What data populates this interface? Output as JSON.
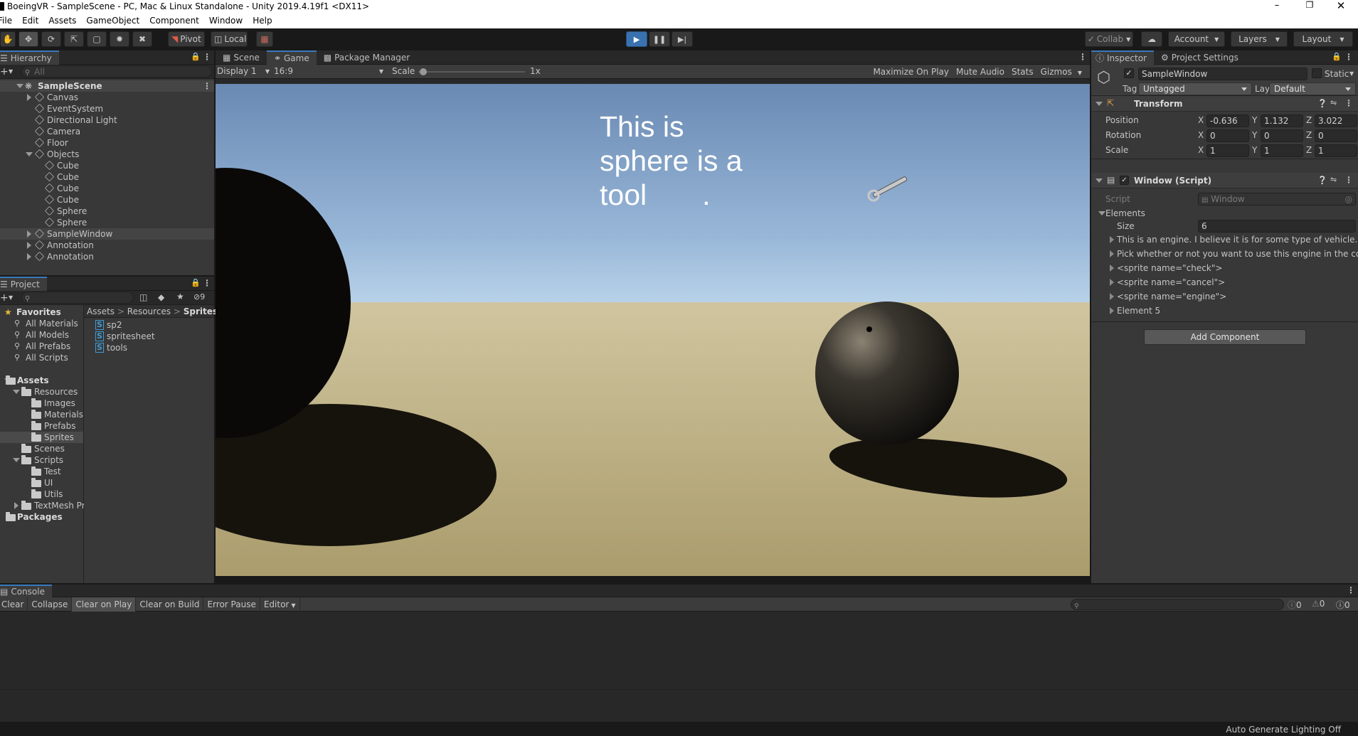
{
  "window": {
    "title": "BoeingVR - SampleScene - PC, Mac & Linux Standalone - Unity 2019.4.19f1 <DX11>"
  },
  "menu": [
    "File",
    "Edit",
    "Assets",
    "GameObject",
    "Component",
    "Window",
    "Help"
  ],
  "toolbar": {
    "pivot": "Pivot",
    "local": "Local",
    "collab": "Collab",
    "account": "Account",
    "layers": "Layers",
    "layout": "Layout"
  },
  "hierarchy": {
    "title": "Hierarchy",
    "search_placeholder": "All",
    "scene": "SampleScene",
    "items": [
      {
        "label": "Canvas",
        "depth": 1,
        "fold": "closed"
      },
      {
        "label": "EventSystem",
        "depth": 1,
        "fold": "none"
      },
      {
        "label": "Directional Light",
        "depth": 1,
        "fold": "none"
      },
      {
        "label": "Camera",
        "depth": 1,
        "fold": "none"
      },
      {
        "label": "Floor",
        "depth": 1,
        "fold": "none"
      },
      {
        "label": "Objects",
        "depth": 1,
        "fold": "open"
      },
      {
        "label": "Cube",
        "depth": 2,
        "fold": "none"
      },
      {
        "label": "Cube",
        "depth": 2,
        "fold": "none"
      },
      {
        "label": "Cube",
        "depth": 2,
        "fold": "none"
      },
      {
        "label": "Cube",
        "depth": 2,
        "fold": "none"
      },
      {
        "label": "Sphere",
        "depth": 2,
        "fold": "none"
      },
      {
        "label": "Sphere",
        "depth": 2,
        "fold": "none"
      },
      {
        "label": "SampleWindow",
        "depth": 1,
        "fold": "closed",
        "selected": true
      },
      {
        "label": "Annotation",
        "depth": 1,
        "fold": "closed"
      },
      {
        "label": "Annotation",
        "depth": 1,
        "fold": "closed"
      }
    ]
  },
  "project": {
    "title": "Project",
    "hidden_count": "9",
    "favorites_label": "Favorites",
    "favorites": [
      "All Materials",
      "All Models",
      "All Prefabs",
      "All Scripts"
    ],
    "tree": [
      {
        "label": "Assets",
        "depth": 0,
        "fold": "open",
        "bold": true
      },
      {
        "label": "Resources",
        "depth": 1,
        "fold": "open"
      },
      {
        "label": "Images",
        "depth": 2,
        "fold": "none"
      },
      {
        "label": "Materials",
        "depth": 2,
        "fold": "none"
      },
      {
        "label": "Prefabs",
        "depth": 2,
        "fold": "none"
      },
      {
        "label": "Sprites",
        "depth": 2,
        "fold": "none",
        "selected": true
      },
      {
        "label": "Scenes",
        "depth": 1,
        "fold": "none"
      },
      {
        "label": "Scripts",
        "depth": 1,
        "fold": "open"
      },
      {
        "label": "Test",
        "depth": 2,
        "fold": "none"
      },
      {
        "label": "UI",
        "depth": 2,
        "fold": "none"
      },
      {
        "label": "Utils",
        "depth": 2,
        "fold": "none"
      },
      {
        "label": "TextMesh Pro",
        "depth": 1,
        "fold": "closed"
      },
      {
        "label": "Packages",
        "depth": 0,
        "fold": "none",
        "bold": true
      }
    ],
    "breadcrumb": [
      "Assets",
      "Resources",
      "Sprites"
    ],
    "files": [
      "sp2",
      "spritesheet",
      "tools"
    ]
  },
  "game": {
    "tabs": [
      "Scene",
      "Game",
      "Package Manager"
    ],
    "display": "Display 1",
    "aspect": "16:9",
    "scale_label": "Scale",
    "scale_value": "1x",
    "maximize": "Maximize On Play",
    "mute": "Mute Audio",
    "stats": "Stats",
    "gizmos": "Gizmos",
    "overlay_lines": [
      "This is",
      "sphere is a",
      "tool"
    ],
    "overlay_period": "."
  },
  "inspector": {
    "tabs": [
      "Inspector",
      "Project Settings"
    ],
    "object_name": "SampleWindow",
    "static_label": "Static",
    "tag_label": "Tag",
    "tag": "Untagged",
    "layer_label": "Layer",
    "layer": "Default",
    "transform": {
      "title": "Transform",
      "rows": [
        {
          "label": "Position",
          "x": "-0.636",
          "y": "1.132",
          "z": "3.022"
        },
        {
          "label": "Rotation",
          "x": "0",
          "y": "0",
          "z": "0"
        },
        {
          "label": "Scale",
          "x": "1",
          "y": "1",
          "z": "1"
        }
      ]
    },
    "script_component": {
      "title": "Window (Script)",
      "script_label": "Script",
      "script_value": "Window",
      "elements_label": "Elements",
      "size_label": "Size",
      "size_value": "6",
      "elements": [
        "This is an engine. I believe it is for some type of vehicle. Look",
        "Pick whether or not you want to use this engine in the constr",
        "<sprite name=\"check\">",
        "<sprite name=\"cancel\">",
        "<sprite name=\"engine\">",
        "Element 5"
      ]
    },
    "add_component": "Add Component"
  },
  "console": {
    "title": "Console",
    "buttons": [
      "Clear",
      "Collapse",
      "Clear on Play",
      "Clear on Build",
      "Error Pause",
      "Editor"
    ],
    "counts": {
      "info": "0",
      "warn": "0",
      "error": "0"
    }
  },
  "status": {
    "text": "Auto Generate Lighting Off"
  },
  "colors": {
    "accent": "#3a79bb",
    "play_active": "#3a72b0",
    "sky_top": "#6d8db6",
    "ground": "#c2b48a"
  }
}
